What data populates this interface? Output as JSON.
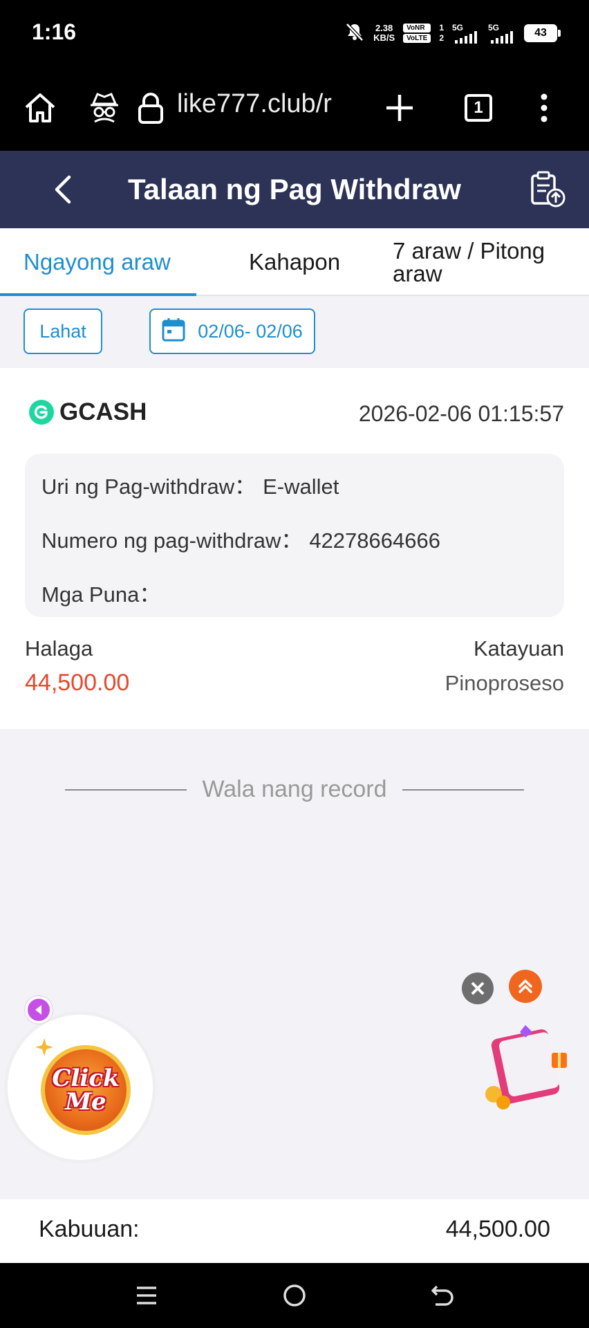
{
  "status_bar": {
    "time": "1:16",
    "net_speed_value": "2.38",
    "net_speed_unit": "KB/S",
    "volte_top": "VoNR",
    "volte_bottom": "VoLTE",
    "sim1": "1",
    "sim2": "2",
    "network1": "5G",
    "network2": "5G",
    "battery": "43"
  },
  "browser": {
    "url": "like777.club/r",
    "tab_count": "1"
  },
  "header": {
    "title": "Talaan ng Pag Withdraw"
  },
  "tabs": [
    {
      "label": "Ngayong araw",
      "active": true
    },
    {
      "label": "Kahapon",
      "active": false
    },
    {
      "label": "7 araw / Pitong araw",
      "active": false
    }
  ],
  "filters": {
    "all_label": "Lahat",
    "date_range": "02/06- 02/06"
  },
  "record": {
    "provider": "GCASH",
    "datetime": "2026-02-06 01:15:57",
    "type_label": "Uri ng Pag-withdraw：",
    "type_value": "E-wallet",
    "number_label": "Numero ng pag-withdraw：",
    "number_value": "42278664666",
    "remarks_label": "Mga Puna：",
    "remarks_value": "",
    "amount_label": "Halaga",
    "amount_value": "44,500.00",
    "status_label": "Katayuan",
    "status_value": "Pinoproseso"
  },
  "empty_message": "Wala nang record",
  "floating": {
    "click_me_line1": "Click",
    "click_me_line2": "Me"
  },
  "total": {
    "label": "Kabuuan:",
    "value": "44,500.00"
  },
  "colors": {
    "header_bg": "#2d3356",
    "accent": "#1f8ecd",
    "amount": "#e8462d",
    "gcash": "#1ed6a1"
  }
}
